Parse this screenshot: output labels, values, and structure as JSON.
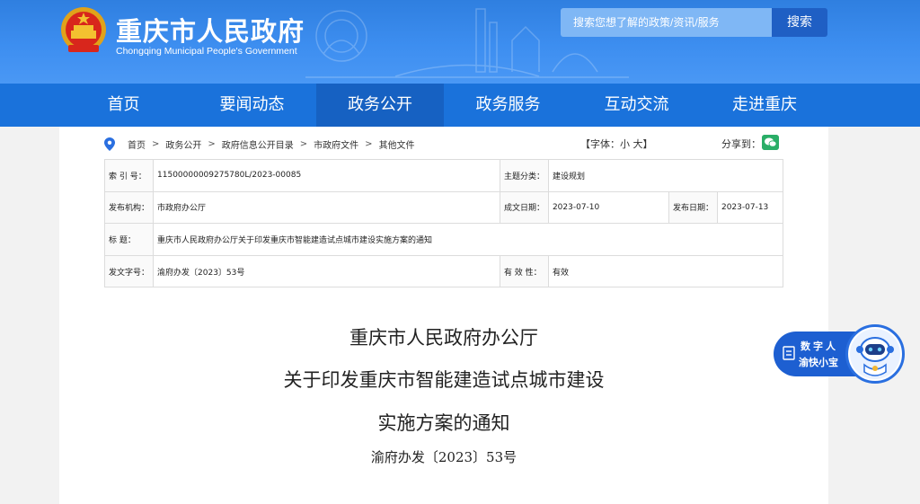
{
  "header": {
    "site_title": "重庆市人民政府",
    "site_subtitle": "Chongqing Municipal People's Government",
    "search_placeholder": "搜索您想了解的政策/资讯/服务",
    "search_button": "搜索"
  },
  "nav": {
    "items": [
      {
        "label": "首页"
      },
      {
        "label": "要闻动态"
      },
      {
        "label": "政务公开",
        "active": true
      },
      {
        "label": "政务服务"
      },
      {
        "label": "互动交流"
      },
      {
        "label": "走进重庆"
      }
    ]
  },
  "breadcrumb": {
    "items": [
      "首页",
      "政务公开",
      "政府信息公开目录",
      "市政府文件",
      "其他文件"
    ],
    "separator": ">"
  },
  "tools": {
    "font_size": "【字体：小 大】",
    "share_label": "分享到："
  },
  "meta": {
    "index_label": "索 引 号：",
    "index_value": "11500000009275780L/2023-00085",
    "topic_label": "主题分类：",
    "topic_value": "建设规划",
    "issuer_label": "发布机构：",
    "issuer_value": "市政府办公厅",
    "written_label": "成文日期：",
    "written_value": "2023-07-10",
    "published_label": "发布日期：",
    "published_value": "2023-07-13",
    "title_label": "标 题：",
    "title_value": "重庆市人民政府办公厅关于印发重庆市智能建造试点城市建设实施方案的通知",
    "docno_label": "发文字号：",
    "docno_value": "渝府办发〔2023〕53号",
    "validity_label": "有 效 性：",
    "validity_value": "有效"
  },
  "document": {
    "title_line1": "重庆市人民政府办公厅",
    "title_line2": "关于印发重庆市智能建造试点城市建设",
    "title_line3": "实施方案的通知",
    "number": "渝府办发〔2023〕53号"
  },
  "assistant": {
    "line1": "数字人",
    "line2": "渝快小宝"
  },
  "colors": {
    "header_blue": "#3a8aea",
    "nav_blue": "#1a72db",
    "nav_active": "#1661c2",
    "emblem_red": "#d8261c",
    "wechat_green": "#2aae67"
  }
}
